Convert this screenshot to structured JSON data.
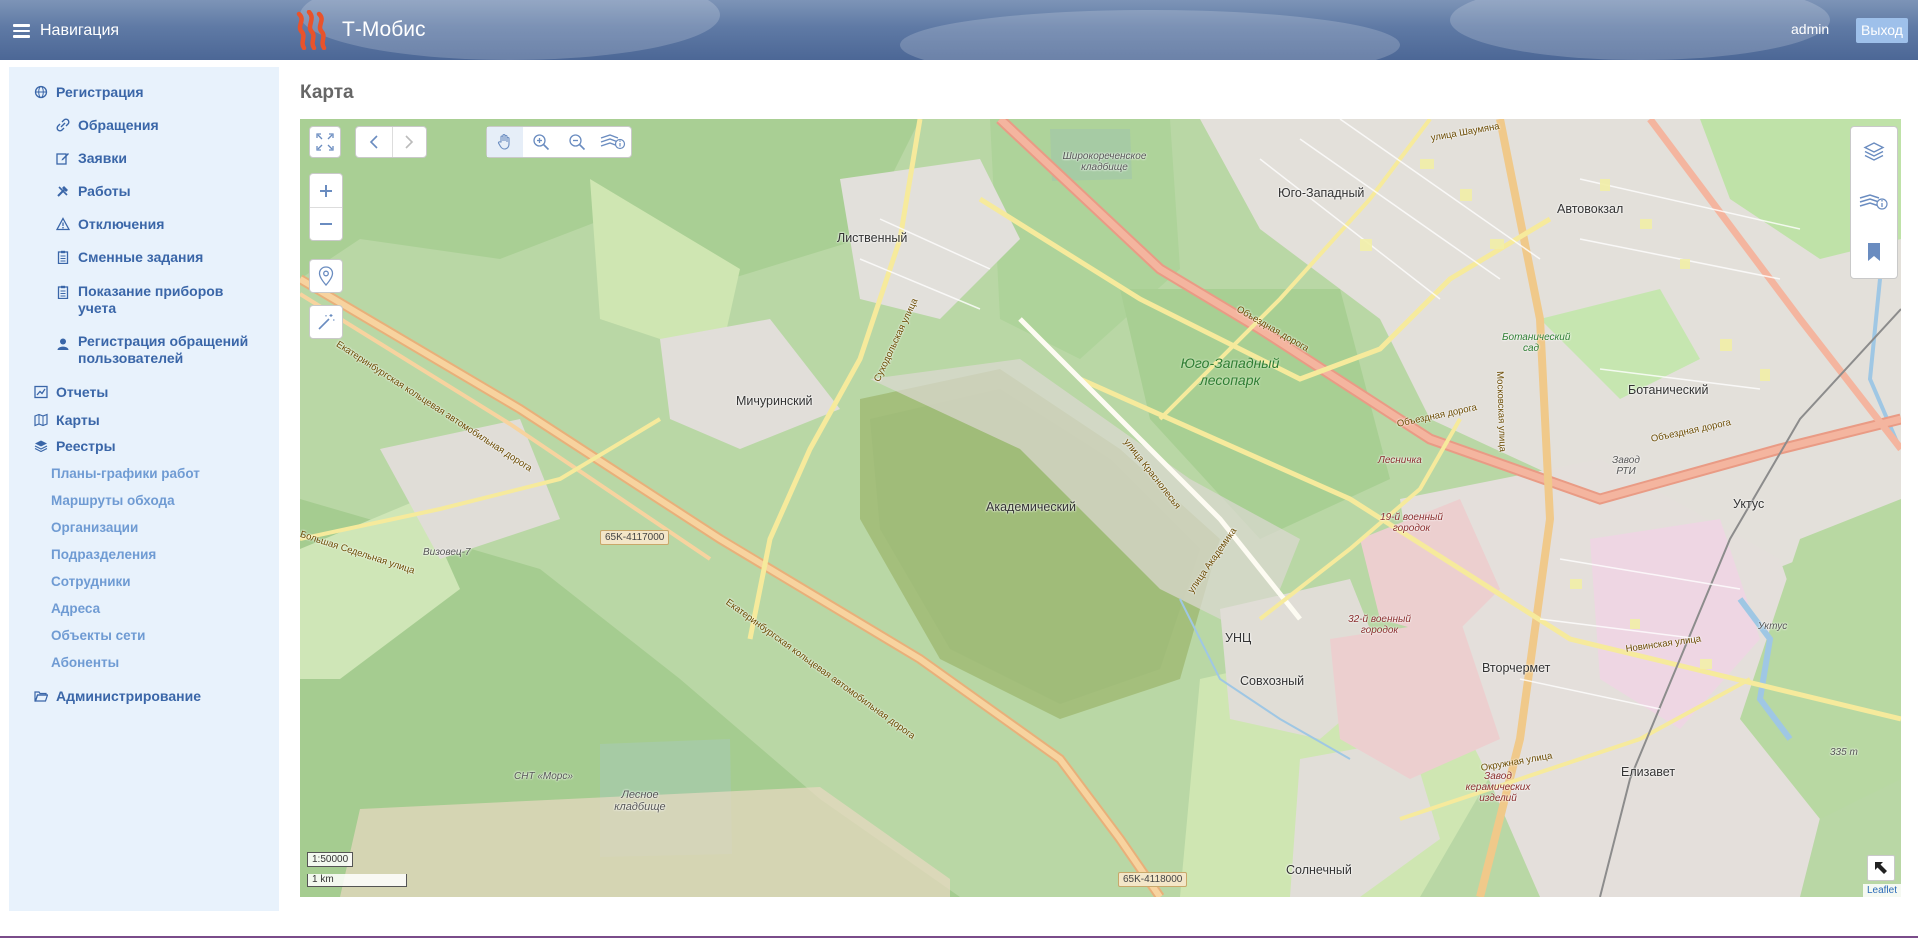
{
  "app": {
    "nav_label": "Навигация",
    "brand_title": "Т-Мобис",
    "user": "admin",
    "logout": "Выход",
    "page_title": "Карта"
  },
  "colors": {
    "header": "#5f7aa5",
    "sidebar_bg": "#e8f2fc",
    "sidebar_link": "#3a66a8",
    "sidebar_registry_link": "#6f9bd3",
    "logout_bg": "#9ec0ea",
    "logo": "#e8532b"
  },
  "sidebar": {
    "registration": "Регистрация",
    "registration_items": [
      {
        "label": "Обращения",
        "icon": "link-icon"
      },
      {
        "label": "Заявки",
        "icon": "edit-icon"
      },
      {
        "label": "Работы",
        "icon": "tools-icon"
      },
      {
        "label": "Отключения",
        "icon": "warning-icon"
      },
      {
        "label": "Сменные задания",
        "icon": "clipboard-icon"
      },
      {
        "label": "Показание приборов учета",
        "icon": "clipboard-icon"
      },
      {
        "label": "Регистрация обращений пользователей",
        "icon": "user-icon"
      }
    ],
    "reports": "Отчеты",
    "maps": "Карты",
    "registries": "Реестры",
    "registry_items": [
      "Планы-графики работ",
      "Маршруты обхода",
      "Организации",
      "Подразделения",
      "Сотрудники",
      "Адреса",
      "Объекты сети",
      "Абоненты"
    ],
    "administration": "Администрирование"
  },
  "map": {
    "scale_ratio": "1:50000",
    "scale_bar": "1 km",
    "attribution": "Leaflet",
    "place_labels": {
      "yugo_zapadny": "Юго-Западный",
      "avtovokzal": "Автовокзал",
      "listvenny": "Лиственный",
      "michurinsky": "Мичуринский",
      "akademichesky": "Академический",
      "botanichesky": "Ботанический",
      "uktus": "Уктус",
      "vtorchermet": "Вторчермет",
      "unc": "УНЦ",
      "sovkhozny": "Совхозный",
      "elizavet": "Елизавет",
      "solnechny": "Солнечный"
    },
    "park_labels": {
      "lesopark": "Юго-Западный лесопарк",
      "lesnoe": "Лесное кладбище"
    },
    "minor_labels": {
      "shirokorechenskoe": "Широкореченское кладбище",
      "botanichesky_sad": "Ботанический сад",
      "zavod_rti": "Завод РТИ",
      "lesnichka": "Лесничка",
      "gorodok19": "19-й военный городок",
      "gorodok32": "32-й военный городок",
      "zavod_keramicheskih": "Завод керамических изделий",
      "vizovets": "Визовец-7",
      "snt_mors": "СНТ «Морс»",
      "uktus_small": "Уктус",
      "elevation": "335 m"
    },
    "road_labels": {
      "ekad1": "Екатеринбургская кольцевая автомобильная дорога",
      "ekad2": "Екатеринбургская кольцевая автомобильная дорога",
      "obezdnaya1": "Объездная дорога",
      "obezdnaya2": "Объездная дорога",
      "obezdnaya3": "Объездная дорога",
      "moskovskaya": "Московская улица",
      "bolshaya_sedelnaya": "Большая Седельная улица",
      "krasnolesya": "улица Краснолесья",
      "akademika": "улица Академика",
      "shaumyana": "улица Шаумяна",
      "okruzhnaya": "Окружная улица",
      "novinskaya": "Новинская улица",
      "sukholozskaya": "Суходольская улица"
    },
    "road_shields": [
      "65K-4117000",
      "65K-4118000"
    ]
  }
}
